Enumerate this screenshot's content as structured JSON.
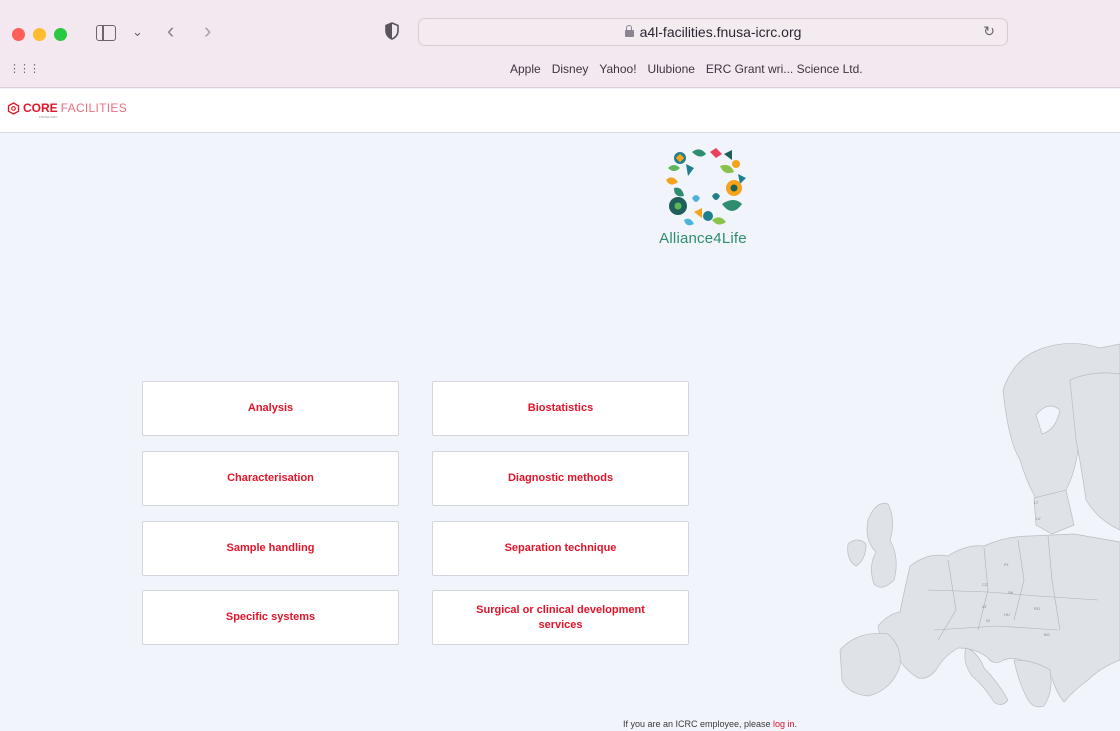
{
  "browser": {
    "url": "a4l-facilities.fnusa-icrc.org",
    "favorites": [
      "Apple",
      "Disney",
      "Yahoo!",
      "Ulubione",
      "ERC Grant wri... Science Ltd."
    ]
  },
  "header": {
    "brand_core": "CORE",
    "brand_facilities": "FACILITIES",
    "brand_sub": "FNUSA-ICRC"
  },
  "logo": {
    "name": "Alliance4Life"
  },
  "categories": [
    {
      "label": "Analysis"
    },
    {
      "label": "Biostatistics"
    },
    {
      "label": "Characterisation"
    },
    {
      "label": "Diagnostic methods"
    },
    {
      "label": "Sample handling"
    },
    {
      "label": "Separation technique"
    },
    {
      "label": "Specific systems"
    },
    {
      "label": "Surgical or clinical development services"
    }
  ],
  "footer": {
    "text": "If you are an ICRC employee, please ",
    "link": "log in",
    "suffix": "."
  },
  "colors": {
    "accent": "#e3142a",
    "brand_green": "#2e8c70",
    "page_bg": "#f1f4fa"
  }
}
